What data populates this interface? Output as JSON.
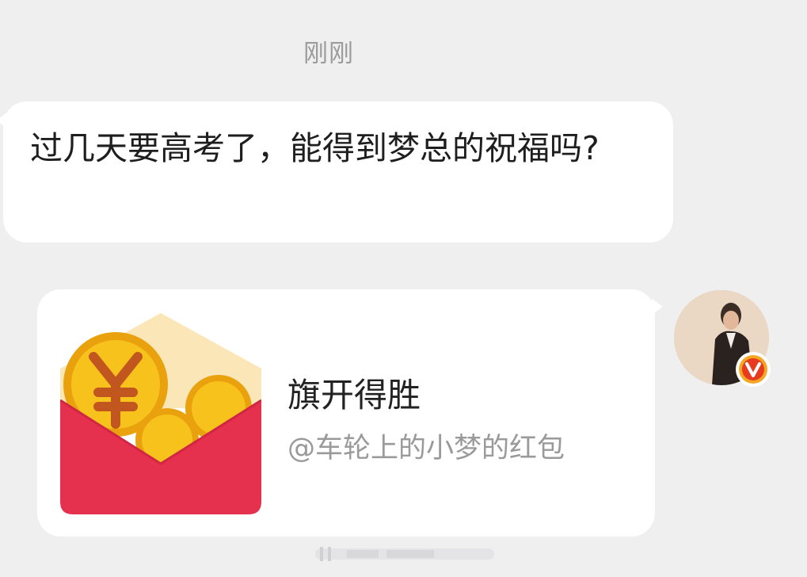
{
  "chat": {
    "timestamp": "刚刚",
    "incoming_message": "过几天要高考了，能得到梦总的祝福吗?",
    "red_packet": {
      "title": "旗开得胜",
      "subtitle": "@车轮上的小梦的红包"
    }
  },
  "icons": {
    "red_packet": "red-envelope-yuan-icon",
    "avatar": "user-avatar",
    "verified": "verified-v-badge-icon"
  },
  "colors": {
    "background": "#efeff0",
    "bubble": "#ffffff",
    "envelope_red": "#e5314d",
    "coin_gold": "#f8c21c",
    "verified_orange": "#f5a623"
  }
}
